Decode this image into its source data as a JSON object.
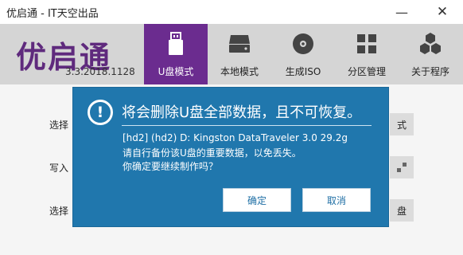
{
  "window": {
    "title": "优启通 - IT天空出品",
    "minimize_icon": "—",
    "close_icon": "✕"
  },
  "header": {
    "logo": "优启通",
    "version": "3.3.2018.1128"
  },
  "tabs": [
    {
      "label": "U盘模式",
      "icon": "usb-drive-icon",
      "active": true
    },
    {
      "label": "本地模式",
      "icon": "hard-drive-icon",
      "active": false
    },
    {
      "label": "生成ISO",
      "icon": "disc-icon",
      "active": false
    },
    {
      "label": "分区管理",
      "icon": "grid-icon",
      "active": false
    },
    {
      "label": "关于程序",
      "icon": "cubes-icon",
      "active": false
    }
  ],
  "content": {
    "row1_label": "选择",
    "row2_label": "写入",
    "row3_label": "选择",
    "row1_side": "式",
    "row3_side": "盘"
  },
  "dialog": {
    "title": "将会删除U盘全部数据，且不可恢复。",
    "line1": "[hd2] (hd2) D: Kingston DataTraveler 3.0 29.2g",
    "line2": "请自行备份该U盘的重要数据，以免丢失。",
    "line3": "你确定要继续制作吗？",
    "ok_label": "确定",
    "cancel_label": "取消",
    "icon_glyph": "!"
  },
  "colors": {
    "accent_purple": "#6b2c8f",
    "dialog_blue": "#2077ad"
  }
}
